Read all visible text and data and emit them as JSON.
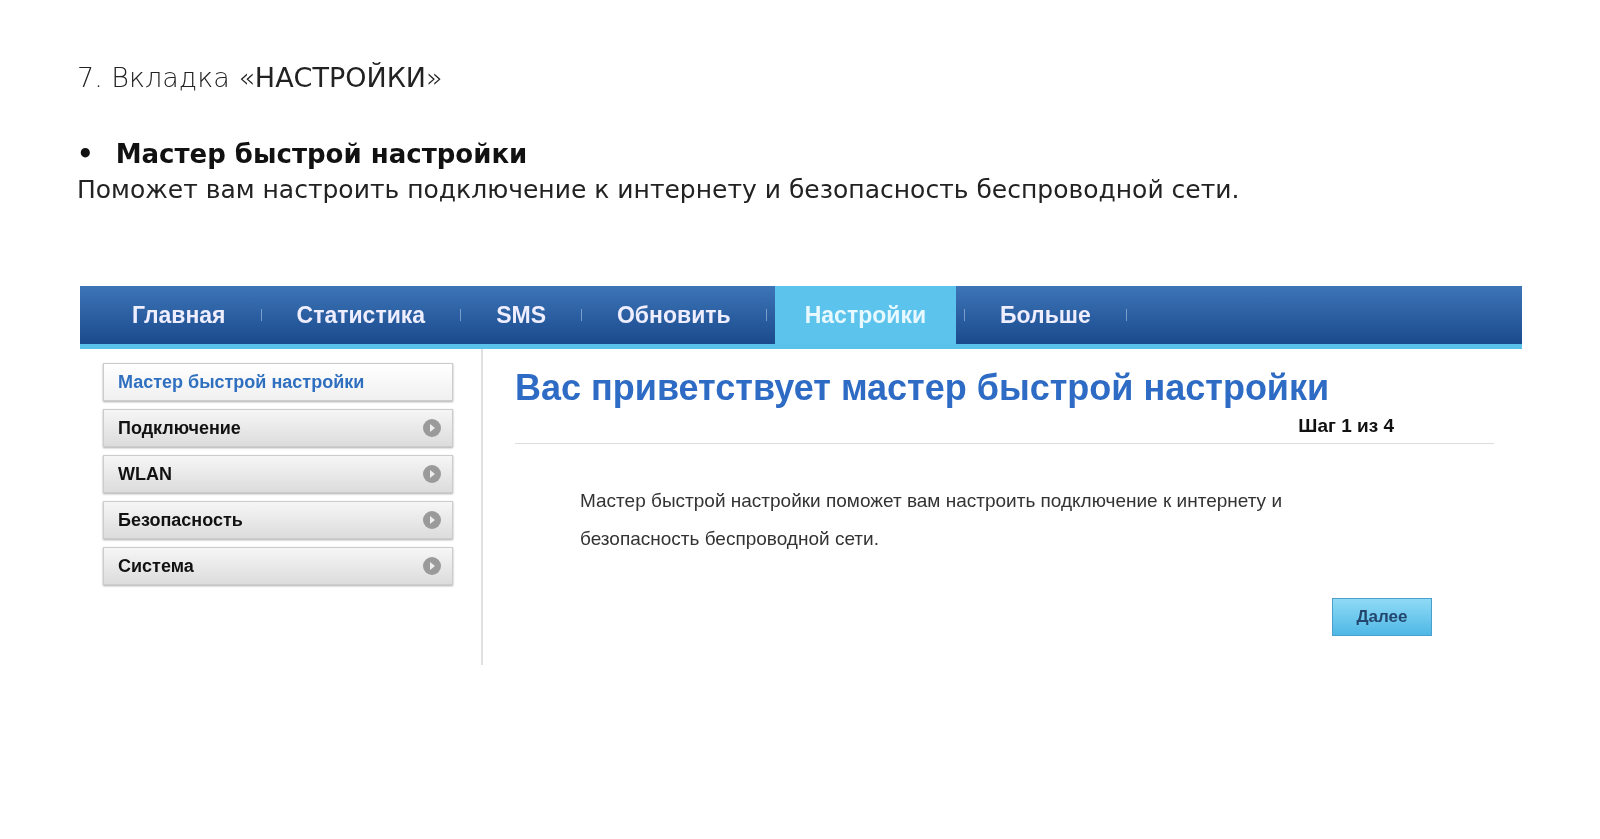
{
  "heading": "7. Вкладка «**НАСТРОЙКИ**»",
  "section": {
    "bullet": "•",
    "title": "Мастер быстрой настройки",
    "text": "Поможет вам настроить подключение к интернету и безопасность беспроводной сети."
  },
  "screenshot": {
    "nav_tabs": [
      {
        "label": "Главная",
        "selected": false
      },
      {
        "label": "Статистика",
        "selected": false
      },
      {
        "label": "SMS",
        "selected": false
      },
      {
        "label": "Обновить",
        "selected": false
      },
      {
        "label": "Настройки",
        "selected": true
      },
      {
        "label": "Больше",
        "selected": false
      }
    ],
    "sidebar": {
      "items": [
        {
          "label": "Мастер быстрой настройки",
          "selected": true
        },
        {
          "label": "Подключение",
          "selected": false
        },
        {
          "label": "WLAN",
          "selected": false
        },
        {
          "label": "Безопасность",
          "selected": false
        },
        {
          "label": "Система",
          "selected": false
        }
      ]
    },
    "content": {
      "title": "Вас приветствует мастер быстрой настройки",
      "step": "Шаг 1 из 4",
      "description": "Мастер быстрой настройки поможет вам настроить подключение к интернету и безопасность беспроводной сети.",
      "next_button": "Далее"
    }
  }
}
